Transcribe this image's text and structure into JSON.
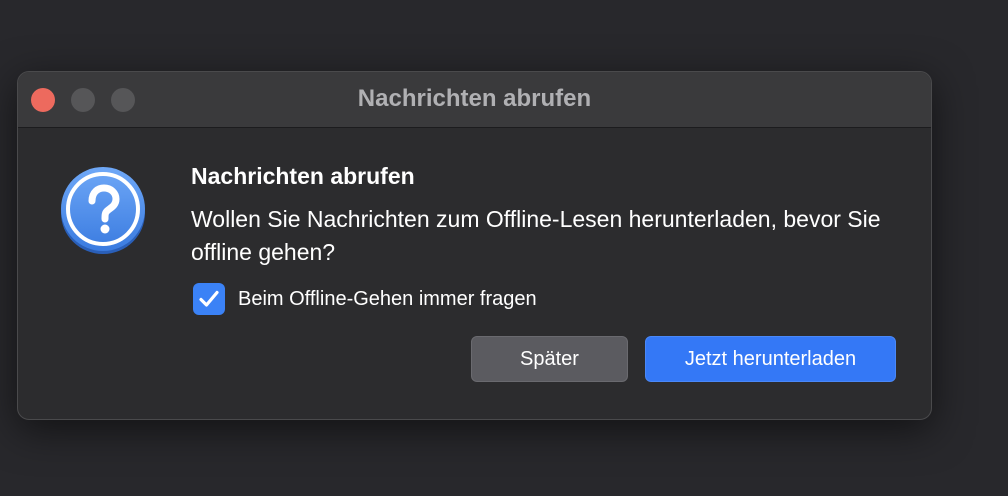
{
  "window": {
    "title": "Nachrichten abrufen"
  },
  "dialog": {
    "icon": "question-mark-icon",
    "heading": "Nachrichten abrufen",
    "message": "Wollen Sie Nachrichten zum Offline-Lesen herunterladen, bevor Sie offline gehen?",
    "checkbox": {
      "label": "Beim Offline-Gehen immer fragen",
      "checked": true
    },
    "buttons": {
      "later": "Später",
      "download": "Jetzt herunterladen"
    }
  },
  "colors": {
    "accent": "#3478f6",
    "close": "#ed6a5e",
    "inactive_control": "#565658"
  }
}
